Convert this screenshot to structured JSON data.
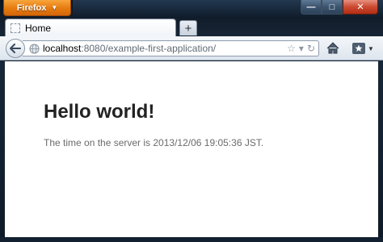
{
  "app_button": {
    "label": "Firefox"
  },
  "window_controls": {
    "minimize": "—",
    "maximize": "□",
    "close": "✕"
  },
  "tabs": [
    {
      "title": "Home"
    }
  ],
  "new_tab": {
    "label": "+"
  },
  "url": {
    "host": "localhost",
    "rest": ":8080/example-first-application/"
  },
  "page": {
    "heading": "Hello world!",
    "text": "The time on the server is 2013/12/06 19:05:36 JST."
  }
}
